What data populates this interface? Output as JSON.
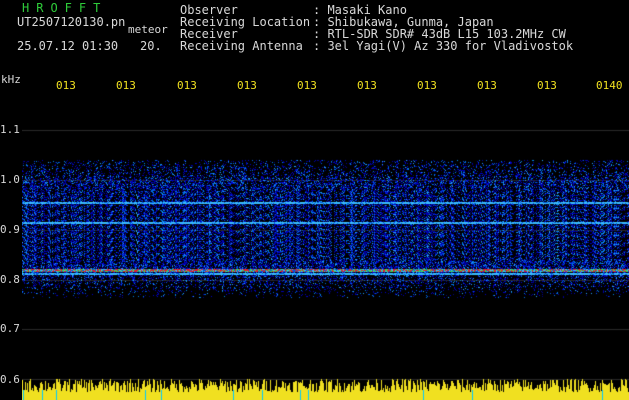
{
  "header": {
    "brand": "HROFFT",
    "filename": "UT2507120130.pn",
    "meteor_label": "meteor",
    "datetime": "25.07.12 01:30",
    "datetime_suffix": "20."
  },
  "info": {
    "labels": [
      "Observer",
      "Receiving Location",
      "Receiver",
      "Receiving Antenna"
    ],
    "values": [
      ": Masaki Kano",
      ": Shibukawa, Gunma, Japan",
      ": RTL-SDR SDR# 43dB L15 103.2MHz CW",
      ": 3el Yagi(V) Az 330 for Vladivostok"
    ]
  },
  "axis": {
    "y_unit": "kHz",
    "y_ticks": [
      "1.1",
      "1.0",
      "0.9",
      "0.8",
      "0.7",
      "0.6"
    ],
    "x_ticks": [
      "013",
      "013",
      "013",
      "013",
      "013",
      "013",
      "013",
      "013",
      "013",
      "0140"
    ]
  },
  "colors": {
    "background": "#000000",
    "grid": "#2a2a2a",
    "signal_band": "#e8232a",
    "level_bars": "#f0e020",
    "brand": "#2ecc3a"
  }
}
